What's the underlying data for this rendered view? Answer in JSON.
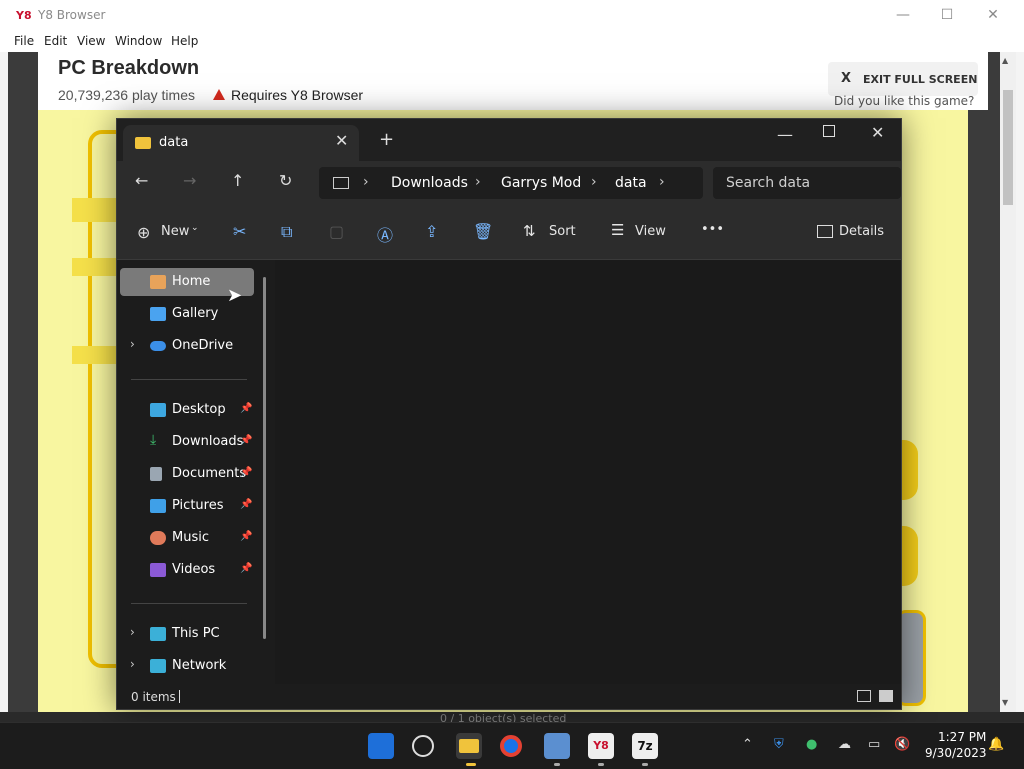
{
  "browser": {
    "logo": "Y8",
    "title": "Y8 Browser",
    "menu": [
      "File",
      "Edit",
      "View",
      "Window",
      "Help"
    ],
    "controls": {
      "minimize": "—",
      "maximize": "☐",
      "close": "✕"
    }
  },
  "game": {
    "title": "PC Breakdown",
    "play_times": "20,739,236 play times",
    "requires": "Requires Y8 Browser",
    "exit_fullscreen_x": "X",
    "exit_fullscreen": "EXIT FULL SCREEN",
    "did_you_like": "Did you like this game?",
    "below_text": "0 / 1 object(s) selected"
  },
  "explorer": {
    "tab_title": "data",
    "tab_close": "✕",
    "new_tab": "+",
    "win_min": "—",
    "win_close": "✕",
    "breadcrumbs": [
      "Downloads",
      "Garrys Mod",
      "data"
    ],
    "search_placeholder": "Search data",
    "commands": {
      "new": "New",
      "sort": "Sort",
      "view": "View",
      "more": "•••",
      "details": "Details"
    },
    "nav": {
      "home": "Home",
      "gallery": "Gallery",
      "onedrive": "OneDrive",
      "desktop": "Desktop",
      "downloads": "Downloads",
      "documents": "Documents",
      "pictures": "Pictures",
      "music": "Music",
      "videos": "Videos",
      "thispc": "This PC",
      "network": "Network"
    },
    "status": "0 items"
  },
  "taskbar": {
    "time": "1:27 PM",
    "date": "9/30/2023",
    "sevenzip": "7z",
    "y8": "Y8"
  },
  "colors": {
    "accent_yellow": "#f5cf1a",
    "game_bg": "#f8f6a0",
    "explorer_bg": "#1c1c1c",
    "selected_nav": "#7a7a7a"
  }
}
